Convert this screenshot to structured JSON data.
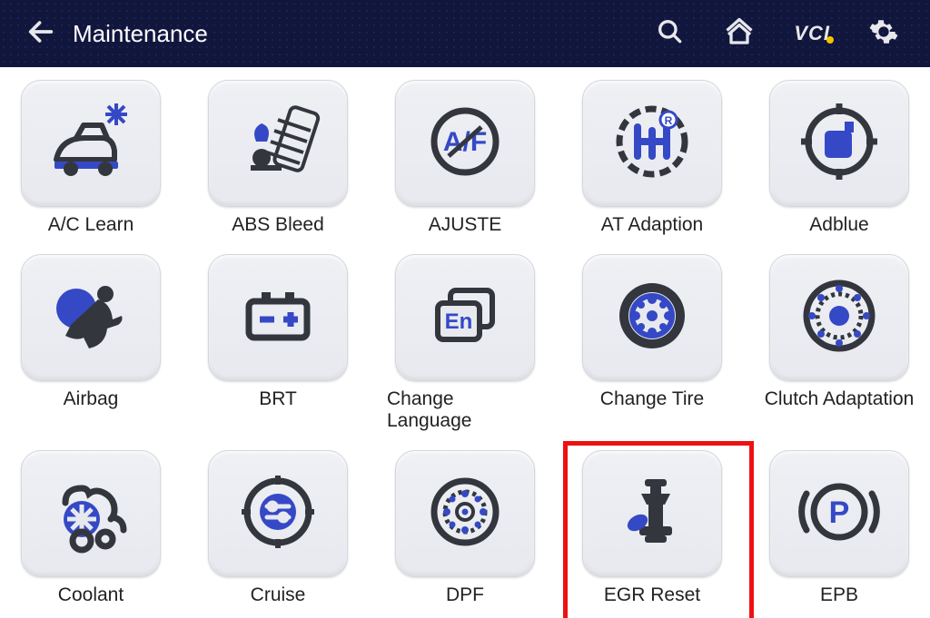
{
  "header": {
    "title": "Maintenance",
    "vci_label": "VCI"
  },
  "colors": {
    "accent": "#3549c6",
    "dark": "#33373d"
  },
  "items": [
    {
      "label": "A/C Learn",
      "icon": "ac-learn-icon",
      "highlighted": false
    },
    {
      "label": "ABS Bleed",
      "icon": "abs-bleed-icon",
      "highlighted": false
    },
    {
      "label": "AJUSTE",
      "icon": "ajuste-icon",
      "highlighted": false
    },
    {
      "label": "AT Adaption",
      "icon": "at-adaption-icon",
      "highlighted": false
    },
    {
      "label": "Adblue",
      "icon": "adblue-icon",
      "highlighted": false
    },
    {
      "label": "Airbag",
      "icon": "airbag-icon",
      "highlighted": false
    },
    {
      "label": "BRT",
      "icon": "brt-icon",
      "highlighted": false
    },
    {
      "label": "Change Language",
      "icon": "change-language-icon",
      "highlighted": false
    },
    {
      "label": "Change Tire",
      "icon": "change-tire-icon",
      "highlighted": false
    },
    {
      "label": "Clutch Adaptation",
      "icon": "clutch-adaptation-icon",
      "highlighted": false
    },
    {
      "label": "Coolant",
      "icon": "coolant-icon",
      "highlighted": false
    },
    {
      "label": "Cruise",
      "icon": "cruise-icon",
      "highlighted": false
    },
    {
      "label": "DPF",
      "icon": "dpf-icon",
      "highlighted": false
    },
    {
      "label": "EGR Reset",
      "icon": "egr-reset-icon",
      "highlighted": true
    },
    {
      "label": "EPB",
      "icon": "epb-icon",
      "highlighted": false
    }
  ]
}
